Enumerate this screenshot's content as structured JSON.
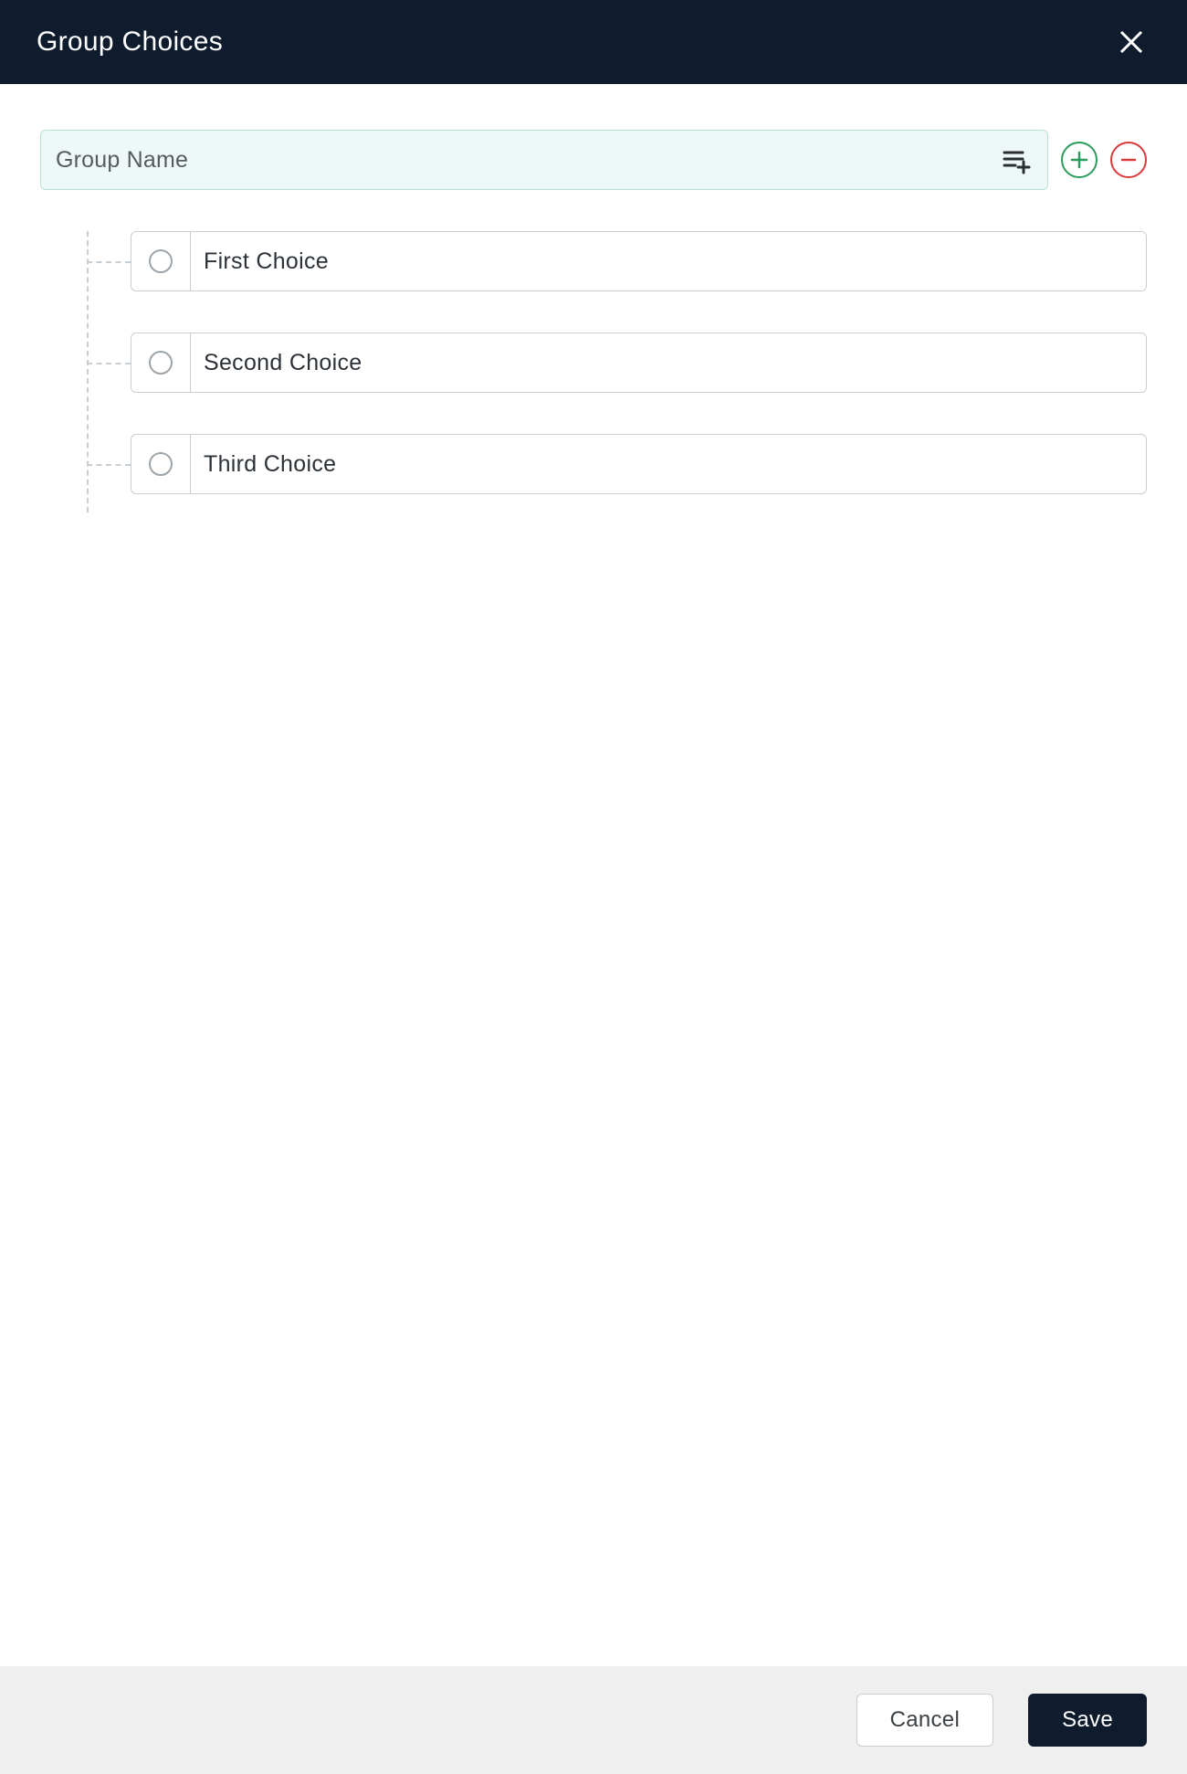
{
  "header": {
    "title": "Group Choices"
  },
  "group": {
    "name_placeholder": "Group Name",
    "name_value": ""
  },
  "choices": [
    {
      "label": "First Choice"
    },
    {
      "label": "Second Choice"
    },
    {
      "label": "Third Choice"
    }
  ],
  "footer": {
    "cancel_label": "Cancel",
    "save_label": "Save"
  }
}
